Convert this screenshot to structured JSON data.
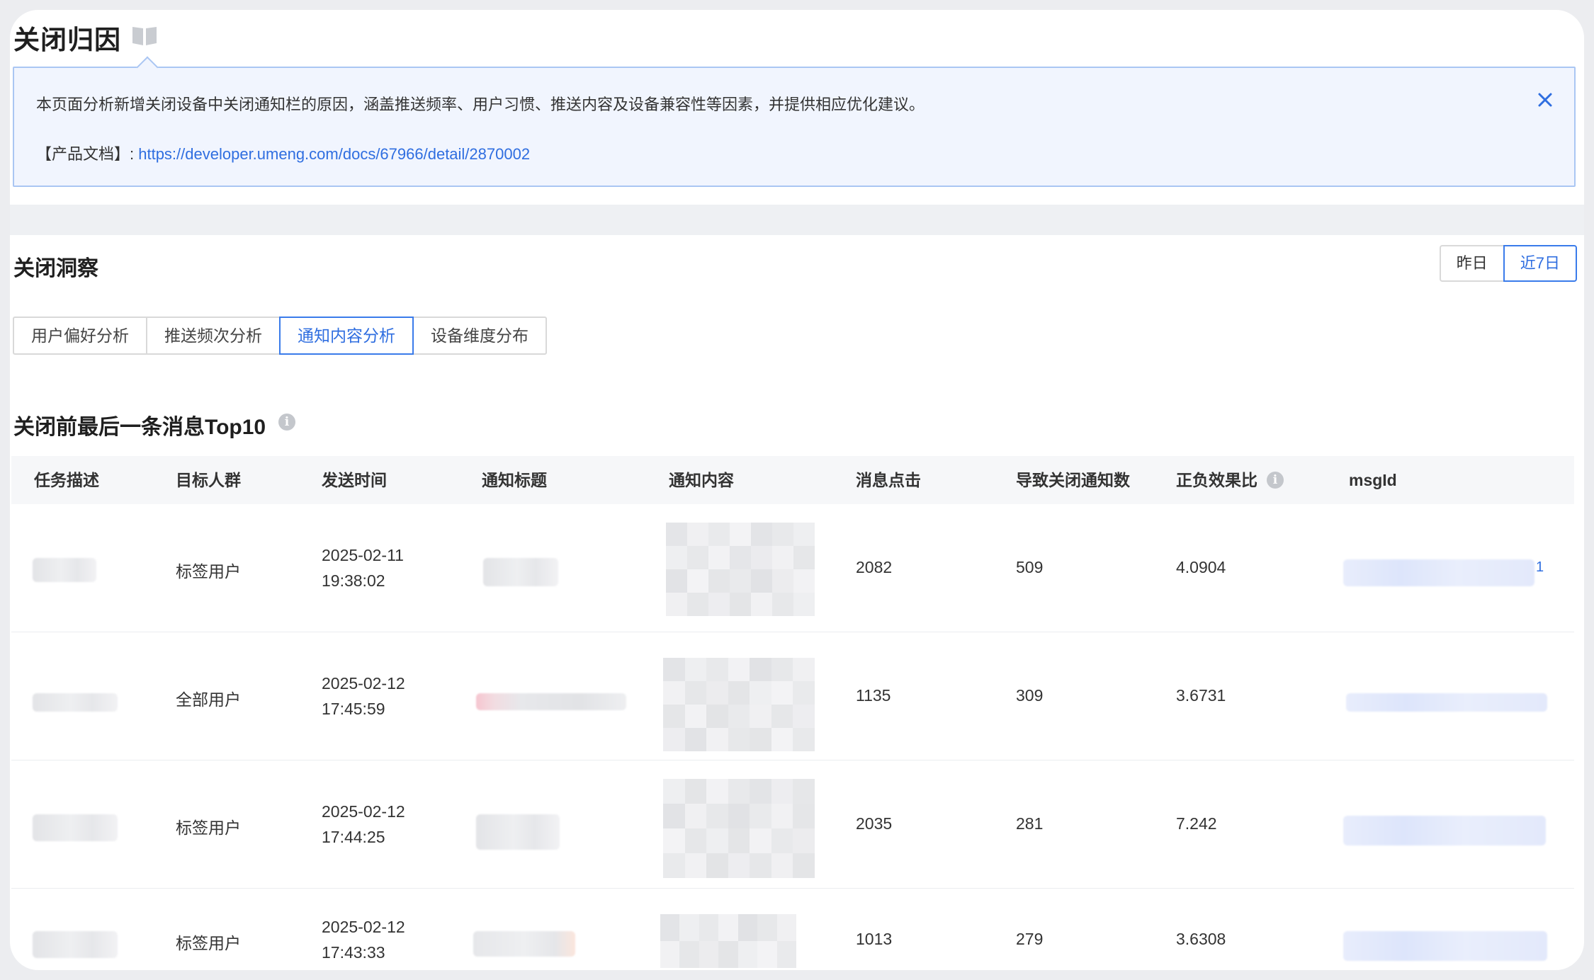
{
  "page": {
    "title": "关闭归因"
  },
  "notice": {
    "text": "本页面分析新增关闭设备中关闭通知栏的原因，涵盖推送频率、用户习惯、推送内容及设备兼容性等因素，并提供相应优化建议。",
    "doc_label": "【产品文档】: ",
    "doc_link": "https://developer.umeng.com/docs/67966/detail/2870002",
    "close_icon": "close-icon"
  },
  "insight": {
    "title": "关闭洞察",
    "range": {
      "yesterday": "昨日",
      "last7": "近7日",
      "selected": "近7日"
    },
    "tabs": [
      "用户偏好分析",
      "推送频次分析",
      "通知内容分析",
      "设备维度分布"
    ],
    "active_tab": "通知内容分析"
  },
  "table": {
    "title": "关闭前最后一条消息Top10",
    "columns": [
      "任务描述",
      "目标人群",
      "发送时间",
      "通知标题",
      "通知内容",
      "消息点击",
      "导致关闭通知数",
      "正负效果比",
      "msgId"
    ],
    "rows": [
      {
        "audience": "标签用户",
        "date": "2025-02-11",
        "time": "19:38:02",
        "clicks": "2082",
        "closes": "509",
        "ratio": "4.0904",
        "msgid_tail": "1"
      },
      {
        "audience": "全部用户",
        "date": "2025-02-12",
        "time": "17:45:59",
        "clicks": "1135",
        "closes": "309",
        "ratio": "3.6731",
        "msgid_tail": ""
      },
      {
        "audience": "标签用户",
        "date": "2025-02-12",
        "time": "17:44:25",
        "clicks": "2035",
        "closes": "281",
        "ratio": "7.242",
        "msgid_tail": ""
      },
      {
        "audience": "标签用户",
        "date": "2025-02-12",
        "time": "17:43:33",
        "clicks": "1013",
        "closes": "279",
        "ratio": "3.6308",
        "msgid_tail": ""
      }
    ]
  },
  "colors": {
    "accent": "#2f6ee0",
    "notice_bg": "#f1f5fe",
    "notice_border": "#aac6f3"
  }
}
